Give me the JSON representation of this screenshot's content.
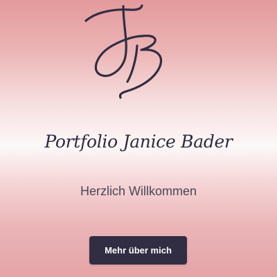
{
  "logo": {
    "text": "JB"
  },
  "hero": {
    "title": "Portfolio Janice Bader",
    "subtitle": "Herzlich Willkommen",
    "cta_label": "Mehr über mich"
  },
  "colors": {
    "ink": "#312e43",
    "text": "#4a4658",
    "gradient_pink": "#e39a9c",
    "gradient_light": "#fdf8f8",
    "button_bg": "#312e43",
    "button_text": "#ffffff"
  }
}
